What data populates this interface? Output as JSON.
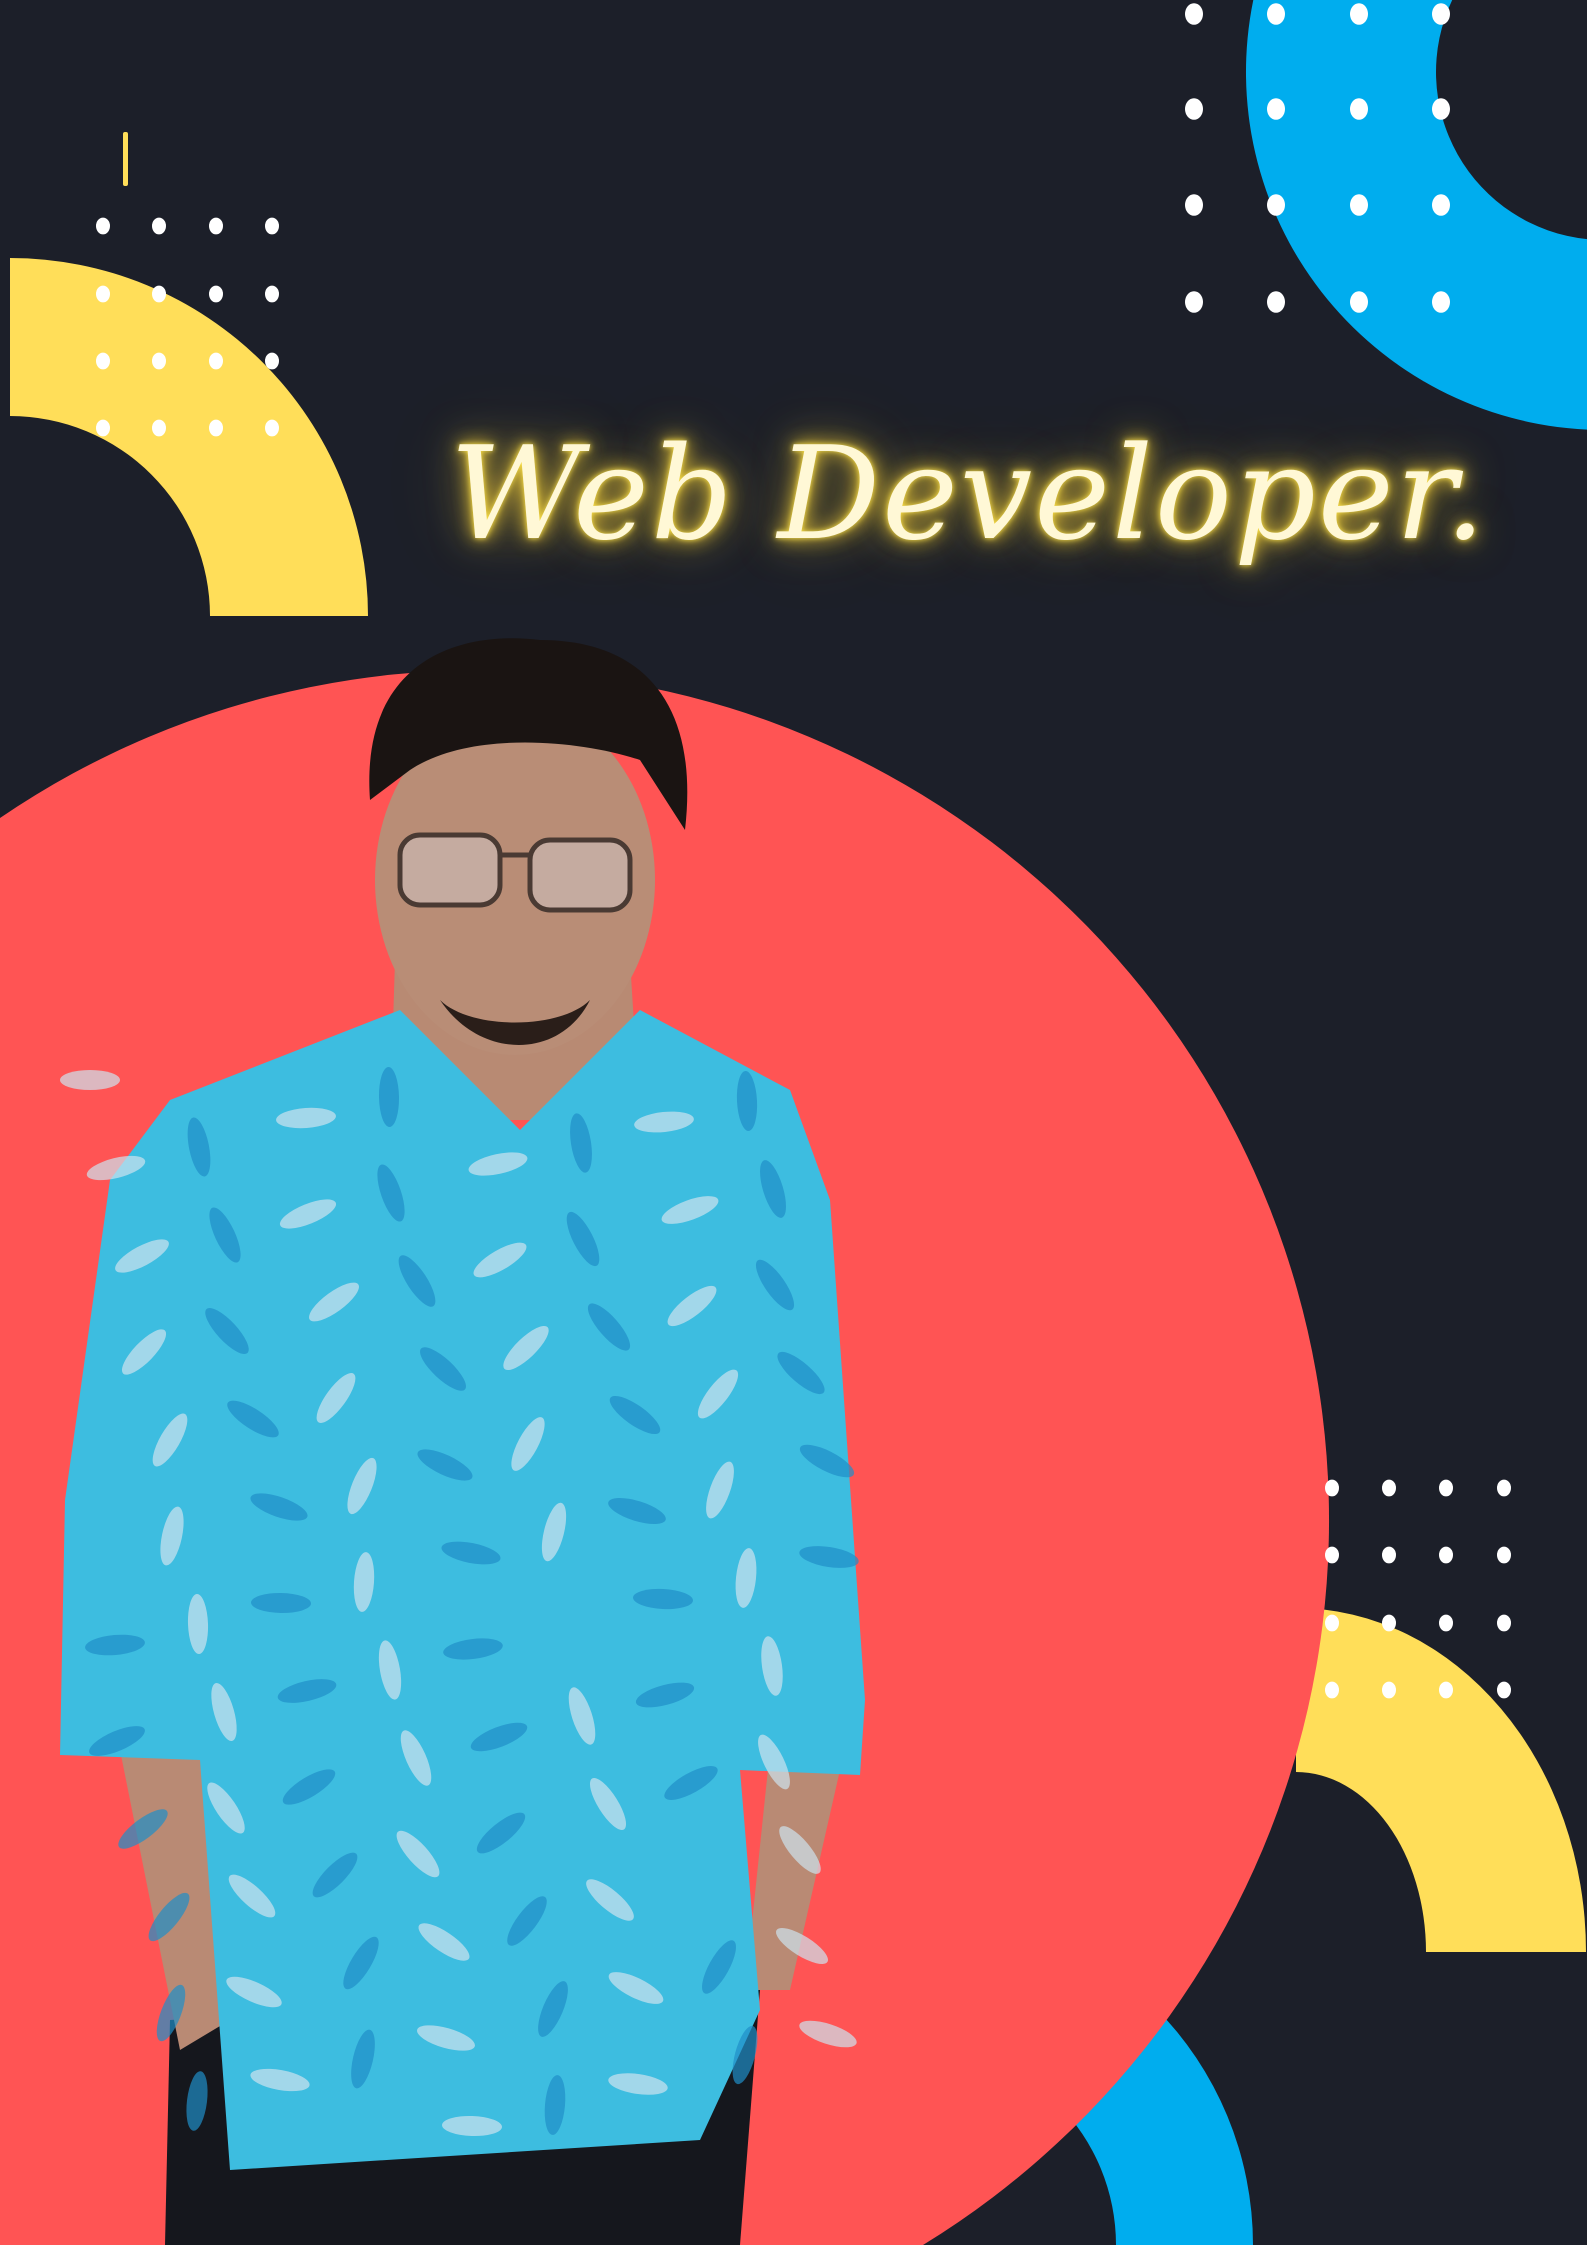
{
  "headline": "Web Developer.",
  "colors": {
    "background": "#1c1f29",
    "yellow": "#ffde59",
    "blue": "#00adee",
    "red": "#ff5454",
    "neon": "#ffe54a",
    "dots": "#ffffff"
  },
  "photo": {
    "subject": "person-portrait",
    "shirt": "blue-floral-shirt"
  }
}
